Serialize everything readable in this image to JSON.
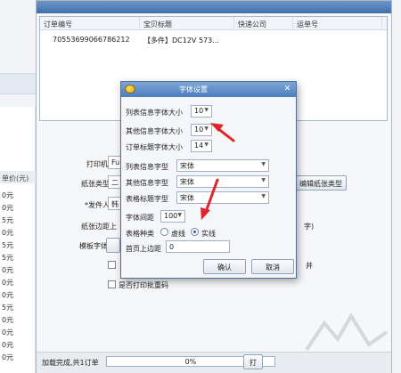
{
  "unit_column": {
    "header": "单价(元)",
    "cells": [
      "0元",
      "0元",
      "5元",
      "0元",
      "5元",
      "5元",
      "0元",
      "0元",
      "0元",
      "5元",
      "0元",
      "0元",
      "0元",
      "0元"
    ]
  },
  "order_table": {
    "headers": [
      "订单编号",
      "宝贝标题",
      "快递公司",
      "运单号"
    ],
    "rows": [
      {
        "order_no": "70553699066786212",
        "title": "【多件】DC12V 573...",
        "courier": "",
        "waybill": ""
      }
    ]
  },
  "print_form": {
    "printer_label": "打印机",
    "printer_value": "Fu",
    "paper_type_label": "纸张类型",
    "paper_type_value": "二",
    "sender_label": "*发件人",
    "sender_value": "韩",
    "paper_margin_label": "纸张边距",
    "paper_margin_value": "上",
    "template_font_label": "模板字体",
    "edit_paper_button": "编辑纸张类型",
    "right_cut_1": "字)",
    "right_cut_2": "井",
    "print_dup_label": "是否打印批重码"
  },
  "progress": {
    "status": "加载完成,共1订单",
    "percent_text": "0%",
    "percent": 0,
    "print_button": "打"
  },
  "font_dialog": {
    "title": "字体设置",
    "list_font_size_label": "列表信息字体大小",
    "list_font_size_value": "10",
    "other_font_size_label": "其他信息字体大小",
    "other_font_size_value": "10",
    "title_font_size_label": "订单标题字体大小",
    "title_font_size_value": "14",
    "list_font_type_label": "列表信息字型",
    "list_font_type_value": "宋体",
    "other_font_type_label": "其他信息字型",
    "other_font_type_value": "宋体",
    "table_font_type_label": "表格标题字型",
    "table_font_type_value": "宋体",
    "line_spacing_label": "字体间距",
    "line_spacing_value": "100",
    "table_style_label": "表格种类",
    "option_dashed": "虚线",
    "option_solid": "实线",
    "selected_style": "实线",
    "top_margin_label": "首页上边距",
    "top_margin_value": "0",
    "ok_button": "确认",
    "cancel_button": "取消"
  },
  "colors": {
    "annotation_red": "#e0262b",
    "title_blue": "#4a7dbf"
  }
}
